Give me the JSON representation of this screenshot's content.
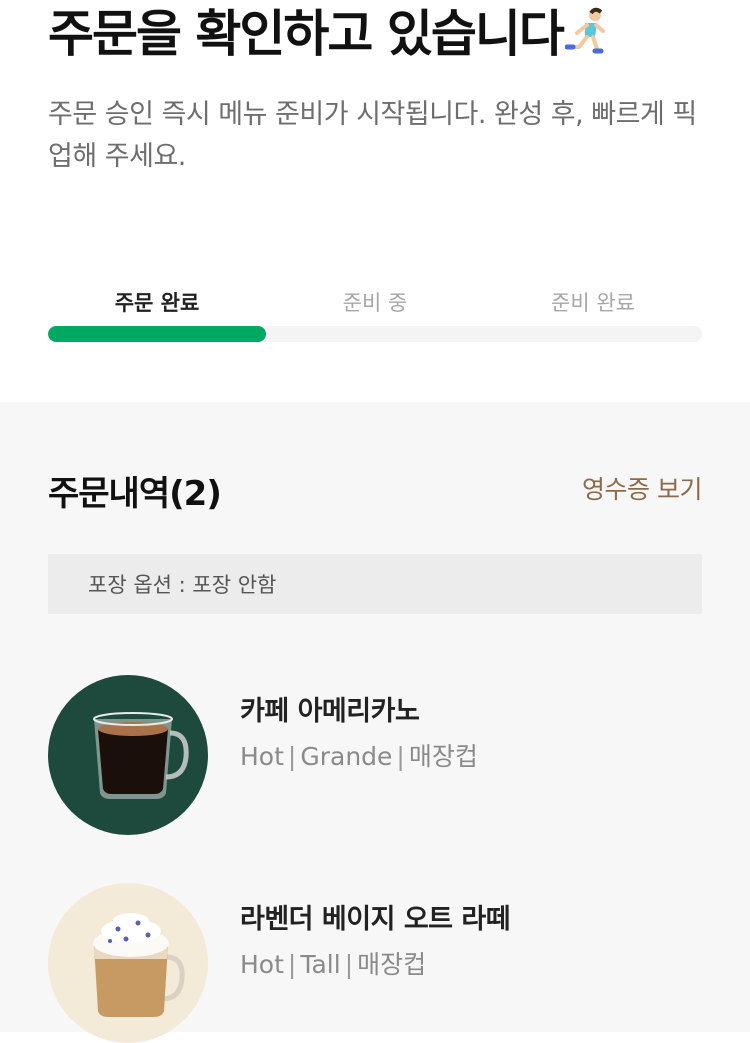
{
  "header": {
    "title": "주문을 확인하고 있습니다",
    "runner_icon": "person-running-icon",
    "subtitle": "주문 승인 즉시 메뉴 준비가 시작됩니다. 완성 후, 빠르게 픽업해 주세요."
  },
  "steps": [
    {
      "label": "주문 완료",
      "active": true
    },
    {
      "label": "준비 중",
      "active": false
    },
    {
      "label": "준비 완료",
      "active": false
    }
  ],
  "progress": {
    "fraction": 0.333,
    "color": "#00a862"
  },
  "order": {
    "title": "주문내역(2)",
    "receipt_label": "영수증 보기",
    "pack_option": "포장 옵션 : 포장 안함",
    "items": [
      {
        "name": "카페 아메리카노",
        "temp": "Hot",
        "size": "Grande",
        "cup": "매장컵",
        "icon": "americano-mug-icon"
      },
      {
        "name": "라벤더 베이지 오트 라떼",
        "temp": "Hot",
        "size": "Tall",
        "cup": "매장컵",
        "icon": "lavender-latte-mug-icon"
      }
    ]
  },
  "colors": {
    "accent": "#00a862",
    "link": "#8b6b4a",
    "item1_bg": "#1e4a3e",
    "item2_bg": "#f3ead8"
  }
}
